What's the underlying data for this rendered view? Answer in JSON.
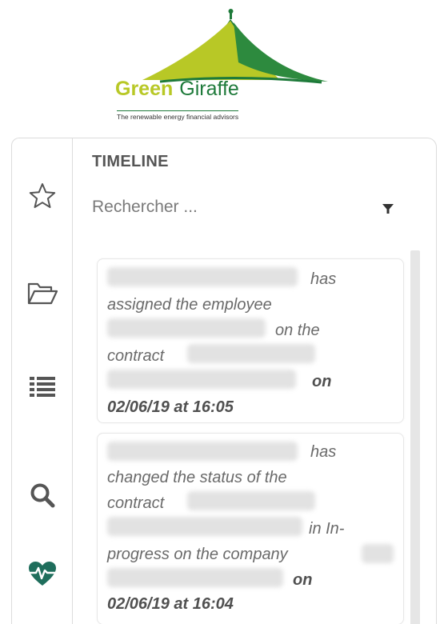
{
  "logo": {
    "word_green": "Green",
    "word_giraffe": "Giraffe",
    "tagline": "The renewable energy financial advisors",
    "colors": {
      "lime": "#b8c826",
      "dark_green": "#1e7a3a"
    }
  },
  "sidebar": {
    "items": [
      {
        "icon": "star-icon"
      },
      {
        "icon": "folder-open-icon"
      },
      {
        "icon": "list-icon"
      },
      {
        "icon": "search-icon"
      },
      {
        "icon": "heart-pulse-icon",
        "active": true
      }
    ]
  },
  "timeline": {
    "title": "TIMELINE",
    "search_placeholder": "Rechercher ...",
    "filter_icon": "filter-icon",
    "events": [
      {
        "lines": [
          "has",
          "assigned the employee",
          "on the",
          "contract",
          "on",
          "02/06/19 at 16:05"
        ],
        "timestamp": "02/06/19 at 16:05"
      },
      {
        "lines": [
          "has",
          "changed the status of the",
          "contract",
          "in In-",
          "progress on the company",
          "on",
          "02/06/19 at 16:04"
        ],
        "timestamp": "02/06/19 at 16:04"
      }
    ]
  },
  "colors": {
    "icon_gray": "#555555",
    "active_icon": "#1f6e5c",
    "border": "#dcdcdc",
    "text_gray": "#6a6a6a"
  }
}
